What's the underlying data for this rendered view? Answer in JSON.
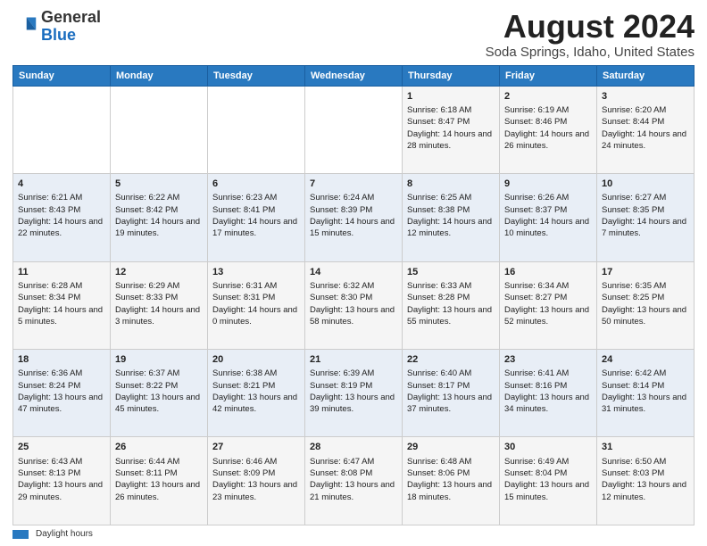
{
  "logo": {
    "general": "General",
    "blue": "Blue"
  },
  "title": "August 2024",
  "subtitle": "Soda Springs, Idaho, United States",
  "days_of_week": [
    "Sunday",
    "Monday",
    "Tuesday",
    "Wednesday",
    "Thursday",
    "Friday",
    "Saturday"
  ],
  "footer_label": "Daylight hours",
  "weeks": [
    [
      {
        "day": "",
        "info": ""
      },
      {
        "day": "",
        "info": ""
      },
      {
        "day": "",
        "info": ""
      },
      {
        "day": "",
        "info": ""
      },
      {
        "day": "1",
        "info": "Sunrise: 6:18 AM\nSunset: 8:47 PM\nDaylight: 14 hours and 28 minutes."
      },
      {
        "day": "2",
        "info": "Sunrise: 6:19 AM\nSunset: 8:46 PM\nDaylight: 14 hours and 26 minutes."
      },
      {
        "day": "3",
        "info": "Sunrise: 6:20 AM\nSunset: 8:44 PM\nDaylight: 14 hours and 24 minutes."
      }
    ],
    [
      {
        "day": "4",
        "info": "Sunrise: 6:21 AM\nSunset: 8:43 PM\nDaylight: 14 hours and 22 minutes."
      },
      {
        "day": "5",
        "info": "Sunrise: 6:22 AM\nSunset: 8:42 PM\nDaylight: 14 hours and 19 minutes."
      },
      {
        "day": "6",
        "info": "Sunrise: 6:23 AM\nSunset: 8:41 PM\nDaylight: 14 hours and 17 minutes."
      },
      {
        "day": "7",
        "info": "Sunrise: 6:24 AM\nSunset: 8:39 PM\nDaylight: 14 hours and 15 minutes."
      },
      {
        "day": "8",
        "info": "Sunrise: 6:25 AM\nSunset: 8:38 PM\nDaylight: 14 hours and 12 minutes."
      },
      {
        "day": "9",
        "info": "Sunrise: 6:26 AM\nSunset: 8:37 PM\nDaylight: 14 hours and 10 minutes."
      },
      {
        "day": "10",
        "info": "Sunrise: 6:27 AM\nSunset: 8:35 PM\nDaylight: 14 hours and 7 minutes."
      }
    ],
    [
      {
        "day": "11",
        "info": "Sunrise: 6:28 AM\nSunset: 8:34 PM\nDaylight: 14 hours and 5 minutes."
      },
      {
        "day": "12",
        "info": "Sunrise: 6:29 AM\nSunset: 8:33 PM\nDaylight: 14 hours and 3 minutes."
      },
      {
        "day": "13",
        "info": "Sunrise: 6:31 AM\nSunset: 8:31 PM\nDaylight: 14 hours and 0 minutes."
      },
      {
        "day": "14",
        "info": "Sunrise: 6:32 AM\nSunset: 8:30 PM\nDaylight: 13 hours and 58 minutes."
      },
      {
        "day": "15",
        "info": "Sunrise: 6:33 AM\nSunset: 8:28 PM\nDaylight: 13 hours and 55 minutes."
      },
      {
        "day": "16",
        "info": "Sunrise: 6:34 AM\nSunset: 8:27 PM\nDaylight: 13 hours and 52 minutes."
      },
      {
        "day": "17",
        "info": "Sunrise: 6:35 AM\nSunset: 8:25 PM\nDaylight: 13 hours and 50 minutes."
      }
    ],
    [
      {
        "day": "18",
        "info": "Sunrise: 6:36 AM\nSunset: 8:24 PM\nDaylight: 13 hours and 47 minutes."
      },
      {
        "day": "19",
        "info": "Sunrise: 6:37 AM\nSunset: 8:22 PM\nDaylight: 13 hours and 45 minutes."
      },
      {
        "day": "20",
        "info": "Sunrise: 6:38 AM\nSunset: 8:21 PM\nDaylight: 13 hours and 42 minutes."
      },
      {
        "day": "21",
        "info": "Sunrise: 6:39 AM\nSunset: 8:19 PM\nDaylight: 13 hours and 39 minutes."
      },
      {
        "day": "22",
        "info": "Sunrise: 6:40 AM\nSunset: 8:17 PM\nDaylight: 13 hours and 37 minutes."
      },
      {
        "day": "23",
        "info": "Sunrise: 6:41 AM\nSunset: 8:16 PM\nDaylight: 13 hours and 34 minutes."
      },
      {
        "day": "24",
        "info": "Sunrise: 6:42 AM\nSunset: 8:14 PM\nDaylight: 13 hours and 31 minutes."
      }
    ],
    [
      {
        "day": "25",
        "info": "Sunrise: 6:43 AM\nSunset: 8:13 PM\nDaylight: 13 hours and 29 minutes."
      },
      {
        "day": "26",
        "info": "Sunrise: 6:44 AM\nSunset: 8:11 PM\nDaylight: 13 hours and 26 minutes."
      },
      {
        "day": "27",
        "info": "Sunrise: 6:46 AM\nSunset: 8:09 PM\nDaylight: 13 hours and 23 minutes."
      },
      {
        "day": "28",
        "info": "Sunrise: 6:47 AM\nSunset: 8:08 PM\nDaylight: 13 hours and 21 minutes."
      },
      {
        "day": "29",
        "info": "Sunrise: 6:48 AM\nSunset: 8:06 PM\nDaylight: 13 hours and 18 minutes."
      },
      {
        "day": "30",
        "info": "Sunrise: 6:49 AM\nSunset: 8:04 PM\nDaylight: 13 hours and 15 minutes."
      },
      {
        "day": "31",
        "info": "Sunrise: 6:50 AM\nSunset: 8:03 PM\nDaylight: 13 hours and 12 minutes."
      }
    ]
  ]
}
